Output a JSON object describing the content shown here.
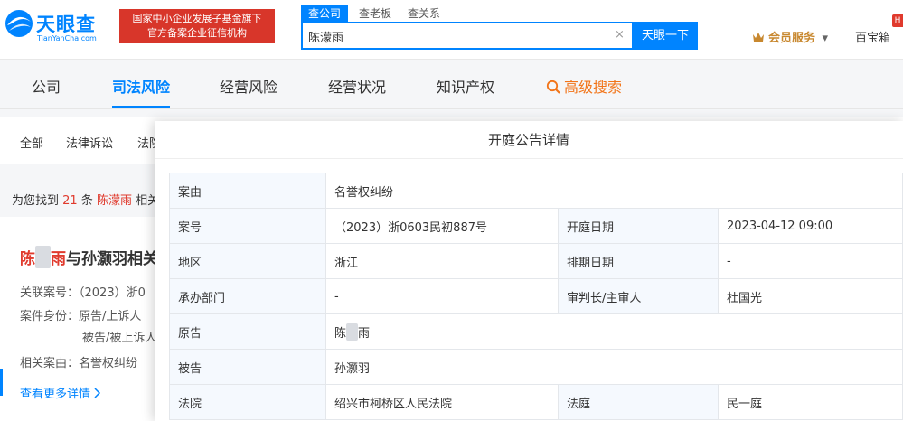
{
  "header": {
    "logo_text": "天眼查",
    "logo_sub": "TianYanCha.com",
    "banner_line1": "国家中小企业发展子基金旗下",
    "banner_line2": "官方备案企业征信机构",
    "search_tabs": [
      "查公司",
      "查老板",
      "查关系"
    ],
    "search_value": "陈濛雨",
    "search_clear": "×",
    "search_button": "天眼一下",
    "vip_label": "会员服务",
    "vip_caret": "▾",
    "treasure_label": "百宝箱",
    "hot_badge": "H"
  },
  "nav": {
    "items": [
      "公司",
      "司法风险",
      "经营风险",
      "经营状况",
      "知识产权",
      "高级搜索"
    ]
  },
  "subbar": {
    "items": [
      "全部",
      "法律诉讼",
      "法院"
    ]
  },
  "results": {
    "prefix": "为您找到",
    "count": "21",
    "mid": "条",
    "name": "陈濛雨",
    "suffix": "相关"
  },
  "card": {
    "title_name_first": "陈",
    "title_name_last": "雨",
    "title_rest": "与孙灏羽相关",
    "line_case_no": "关联案号：（2023）浙0",
    "line_role1": "案件身份：原告/上诉人",
    "line_role2": "被告/被上诉人",
    "line_cause": "相关案由：名誉权纠纷",
    "more_link": "查看更多详情"
  },
  "modal": {
    "title": "开庭公告详情",
    "rows": [
      {
        "k1": "案由",
        "v1": "名誉权纠纷"
      },
      {
        "k1": "案号",
        "v1": "（2023）浙0603民初887号",
        "k2": "开庭日期",
        "v2": "2023-04-12 09:00"
      },
      {
        "k1": "地区",
        "v1": "浙江",
        "k2": "排期日期",
        "v2": "-"
      },
      {
        "k1": "承办部门",
        "v1": "-",
        "k2": "审判长/主审人",
        "v2": "杜国光"
      },
      {
        "k1": "原告",
        "v1_first": "陈",
        "v1_last": "雨"
      },
      {
        "k1": "被告",
        "v1": "孙灏羽"
      },
      {
        "k1": "法院",
        "v1": "绍兴市柯桥区人民法院",
        "k2": "法庭",
        "v2": "民一庭"
      }
    ]
  },
  "colors": {
    "brand_blue": "#0084ff",
    "highlight_red": "#e03a2d",
    "banner_red": "#d8362a",
    "vip_gold": "#c8882f",
    "advanced_orange": "#f27418"
  }
}
